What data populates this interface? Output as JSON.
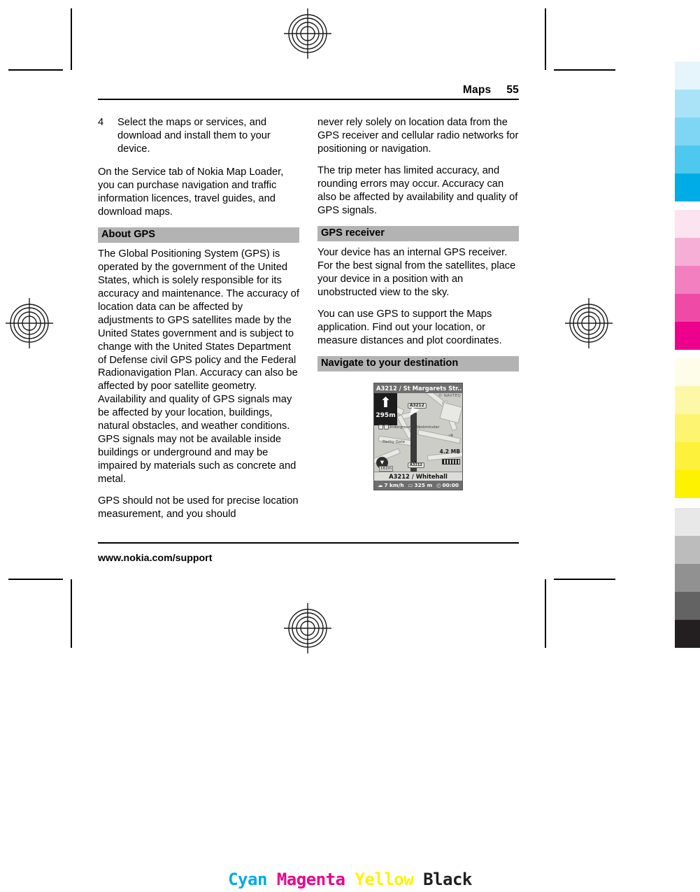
{
  "header": {
    "chapter": "Maps",
    "page_number": "55"
  },
  "left_column": {
    "numbered_item": {
      "number": "4",
      "text": "Select the maps or services, and download and install them to your device."
    },
    "paragraph_1": "On the Service tab of Nokia Map Loader, you can purchase navigation and traffic information licences, travel guides, and download maps.",
    "section_heading": "About GPS",
    "paragraph_2": "The Global Positioning System (GPS) is operated by the government of the United States, which is solely responsible for its accuracy and maintenance. The accuracy of location data can be affected by adjustments to GPS satellites made by the United States government and is subject to change with the United States Department of Defense civil GPS policy and the Federal Radionavigation Plan. Accuracy can also be affected by poor satellite geometry. Availability and quality of GPS signals may be affected by your location, buildings, natural obstacles, and weather conditions. GPS signals may not be available inside buildings or underground and may be impaired by materials such as concrete and metal.",
    "paragraph_3": "GPS should not be used for precise location measurement, and you should"
  },
  "right_column": {
    "paragraph_1": "never rely solely on location data from the GPS receiver and cellular radio networks for positioning or navigation.",
    "paragraph_2": "The trip meter has limited accuracy, and rounding errors may occur. Accuracy can also be affected by availability and quality of GPS signals.",
    "section_heading_1": "GPS receiver",
    "paragraph_3": "Your device has an internal GPS receiver. For the best signal from the satellites, place your device in a position with an unobstructed view to the sky.",
    "paragraph_4": "You can use GPS to support the Maps application. Find out your location, or measure distances and plot coordinates.",
    "section_heading_2": "Navigate to your destination"
  },
  "device_screenshot": {
    "title": "A3212 / St Margarets Str...",
    "copyright": "© NAVTEQ",
    "turn_distance": "295m",
    "turn_arrow": "⬆",
    "road_badge": "A3212",
    "poi_underground": "Underground Westminster",
    "poi_derby": "Derby Gate",
    "zoom_wheel_glyph": "▼",
    "zoom_label": "162m",
    "memory": "4.2 MB",
    "current_street": "A3212 / Whitehall",
    "status": {
      "speed": "7 km/h",
      "speed_icon": "☁",
      "distance": "325 m",
      "distance_icon": "▭",
      "time": "00:00",
      "time_icon": "◴"
    }
  },
  "footer": {
    "url": "www.nokia.com/support"
  },
  "color_bar": {
    "cyan": [
      "#e6f5fc",
      "#aae3f7",
      "#7ed6f4",
      "#4ec8ef",
      "#00ace6"
    ],
    "magenta": [
      "#fbe3ef",
      "#f6aed6",
      "#f27fbf",
      "#ef4ba6",
      "#ec008c"
    ],
    "yellow": [
      "#fefdea",
      "#fdf8a8",
      "#fdf470",
      "#fdf13c",
      "#fff200"
    ],
    "black": [
      "#e8e8e8",
      "#bcbcbc",
      "#919191",
      "#636363",
      "#231f20"
    ]
  },
  "cmyk_legend": {
    "cyan": "Cyan",
    "magenta": "Magenta",
    "yellow": "Yellow",
    "black": "Black",
    "cyan_hex": "#00ace6",
    "magenta_hex": "#ec008c",
    "yellow_hex": "#fff200",
    "black_hex": "#231f20"
  }
}
